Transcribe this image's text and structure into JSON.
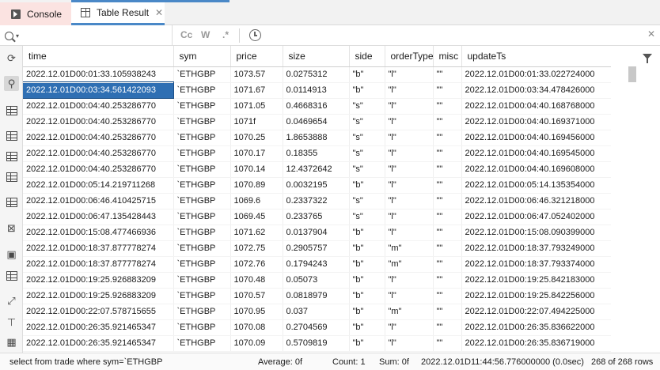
{
  "tabs": [
    {
      "label": "Console"
    },
    {
      "label": "Table Result"
    }
  ],
  "search": {
    "placeholder": "",
    "match_case": "Cc",
    "whole_word": "W",
    "regex": ".*"
  },
  "table": {
    "columns": [
      "time",
      "sym",
      "price",
      "size",
      "side",
      "orderType",
      "misc",
      "updateTs"
    ],
    "rows": [
      [
        "2022.12.01D00:01:33.105938243",
        "`ETHGBP",
        "1073.57",
        "0.0275312",
        "\"b\"",
        "\"l\"",
        "\"\"",
        "2022.12.01D00:01:33.022724000"
      ],
      [
        "2022.12.01D00:03:34.561422093",
        "`ETHGBP",
        "1071.67",
        "0.0114913",
        "\"b\"",
        "\"l\"",
        "\"\"",
        "2022.12.01D00:03:34.478426000"
      ],
      [
        "2022.12.01D00:04:40.253286770",
        "`ETHGBP",
        "1071.05",
        "0.4668316",
        "\"s\"",
        "\"l\"",
        "\"\"",
        "2022.12.01D00:04:40.168768000"
      ],
      [
        "2022.12.01D00:04:40.253286770",
        "`ETHGBP",
        "1071f",
        "0.0469654",
        "\"s\"",
        "\"l\"",
        "\"\"",
        "2022.12.01D00:04:40.169371000"
      ],
      [
        "2022.12.01D00:04:40.253286770",
        "`ETHGBP",
        "1070.25",
        "1.8653888",
        "\"s\"",
        "\"l\"",
        "\"\"",
        "2022.12.01D00:04:40.169456000"
      ],
      [
        "2022.12.01D00:04:40.253286770",
        "`ETHGBP",
        "1070.17",
        "0.18355",
        "\"s\"",
        "\"l\"",
        "\"\"",
        "2022.12.01D00:04:40.169545000"
      ],
      [
        "2022.12.01D00:04:40.253286770",
        "`ETHGBP",
        "1070.14",
        "12.4372642",
        "\"s\"",
        "\"l\"",
        "\"\"",
        "2022.12.01D00:04:40.169608000"
      ],
      [
        "2022.12.01D00:05:14.219711268",
        "`ETHGBP",
        "1070.89",
        "0.0032195",
        "\"b\"",
        "\"l\"",
        "\"\"",
        "2022.12.01D00:05:14.135354000"
      ],
      [
        "2022.12.01D00:06:46.410425715",
        "`ETHGBP",
        "1069.6",
        "0.2337322",
        "\"s\"",
        "\"l\"",
        "\"\"",
        "2022.12.01D00:06:46.321218000"
      ],
      [
        "2022.12.01D00:06:47.135428443",
        "`ETHGBP",
        "1069.45",
        "0.233765",
        "\"s\"",
        "\"l\"",
        "\"\"",
        "2022.12.01D00:06:47.052402000"
      ],
      [
        "2022.12.01D00:15:08.477466936",
        "`ETHGBP",
        "1071.62",
        "0.0137904",
        "\"b\"",
        "\"l\"",
        "\"\"",
        "2022.12.01D00:15:08.090399000"
      ],
      [
        "2022.12.01D00:18:37.877778274",
        "`ETHGBP",
        "1072.75",
        "0.2905757",
        "\"b\"",
        "\"m\"",
        "\"\"",
        "2022.12.01D00:18:37.793249000"
      ],
      [
        "2022.12.01D00:18:37.877778274",
        "`ETHGBP",
        "1072.76",
        "0.1794243",
        "\"b\"",
        "\"m\"",
        "\"\"",
        "2022.12.01D00:18:37.793374000"
      ],
      [
        "2022.12.01D00:19:25.926883209",
        "`ETHGBP",
        "1070.48",
        "0.05073",
        "\"b\"",
        "\"l\"",
        "\"\"",
        "2022.12.01D00:19:25.842183000"
      ],
      [
        "2022.12.01D00:19:25.926883209",
        "`ETHGBP",
        "1070.57",
        "0.0818979",
        "\"b\"",
        "\"l\"",
        "\"\"",
        "2022.12.01D00:19:25.842256000"
      ],
      [
        "2022.12.01D00:22:07.578715655",
        "`ETHGBP",
        "1070.95",
        "0.037",
        "\"b\"",
        "\"m\"",
        "\"\"",
        "2022.12.01D00:22:07.494225000"
      ],
      [
        "2022.12.01D00:26:35.921465347",
        "`ETHGBP",
        "1070.08",
        "0.2704569",
        "\"b\"",
        "\"l\"",
        "\"\"",
        "2022.12.01D00:26:35.836622000"
      ],
      [
        "2022.12.01D00:26:35.921465347",
        "`ETHGBP",
        "1070.09",
        "0.5709819",
        "\"b\"",
        "\"l\"",
        "\"\"",
        "2022.12.01D00:26:35.836719000"
      ]
    ],
    "selected_row": 1,
    "selected_col": 0
  },
  "status": {
    "query": "select from trade where sym=`ETHGBP",
    "average": "Average: 0f",
    "count": "Count: 1",
    "sum": "Sum: 0f",
    "timestamp": "2022.12.01D11:44:56.776000000 (0.0sec)",
    "rows": "268 of 268 rows"
  }
}
